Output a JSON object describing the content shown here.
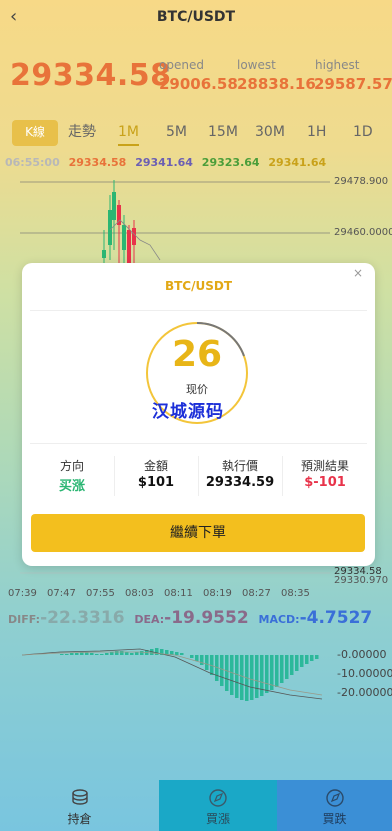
{
  "header": {
    "back_icon": "chevron-left-icon",
    "title": "BTC/USDT"
  },
  "price": {
    "current": "29334.58",
    "opened_label": "opened",
    "opened": "29006.58",
    "lowest_label": "lowest",
    "lowest": "28838.16",
    "highest_label": "highest",
    "highest": "29587.57"
  },
  "tabs": {
    "kline": "K線",
    "trend": "走勢",
    "periods": [
      "1M",
      "5M",
      "15M",
      "30M",
      "1H",
      "1D"
    ],
    "active_period": "1M"
  },
  "ohlc": {
    "time": "06:55:00",
    "open": "29334.58",
    "high": "29341.64",
    "low": "29323.64",
    "close": "29341.64"
  },
  "chart_data": {
    "type": "candlestick",
    "y_ticks": [
      "29478.900",
      "29460.0000",
      "29334.58",
      "29330.970"
    ],
    "x_ticks": [
      "07:39",
      "07:47",
      "07:55",
      "08:03",
      "08:11",
      "08:19",
      "08:27",
      "08:35"
    ]
  },
  "macd": {
    "diff_label": "DIFF:",
    "diff": "-22.3316",
    "dea_label": "DEA:",
    "dea": "-19.9552",
    "macd_label": "MACD:",
    "macd": "-4.7527",
    "ticks": [
      "-0.00000",
      "-10.00000",
      "-20.00000"
    ]
  },
  "modal": {
    "title": "BTC/USDT",
    "close_icon": "close-icon",
    "countdown": "26",
    "current_label": "现价",
    "watermark": "汉城源码",
    "direction_label": "方向",
    "direction": "买涨",
    "amount_label": "金額",
    "amount": "$101",
    "exec_label": "執行價",
    "exec_price": "29334.59",
    "result_label": "預測結果",
    "result": "$-101",
    "continue_button": "繼續下單"
  },
  "bottom_nav": {
    "positions": "持倉",
    "buy_up": "買漲",
    "buy_down": "買跌"
  },
  "colors": {
    "accent": "#e8733a",
    "gold": "#e2a816",
    "up": "#2bb673",
    "down": "#e8334a"
  }
}
